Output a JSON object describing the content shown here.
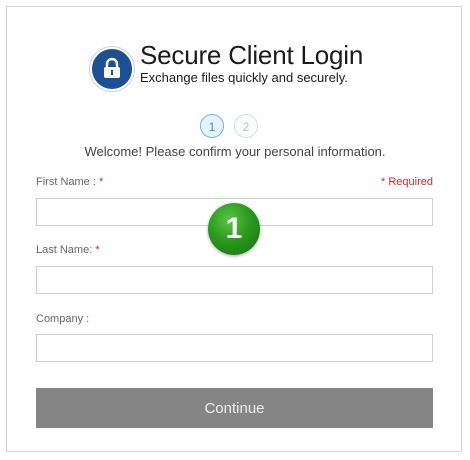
{
  "header": {
    "title": "Secure Client Login",
    "subtitle": "Exchange files quickly and securely.",
    "icon": "lock-icon",
    "icon_color": "#1d4f94"
  },
  "steps": [
    {
      "label": "1",
      "active": true
    },
    {
      "label": "2",
      "active": false
    }
  ],
  "welcome_text": "Welcome! Please confirm your personal information.",
  "required_note": "* Required",
  "form": {
    "first_name": {
      "label": "First Name :",
      "required_mark": "*",
      "value": "",
      "placeholder": ""
    },
    "last_name": {
      "label": "Last Name:",
      "required_mark": "*",
      "value": "",
      "placeholder": ""
    },
    "company": {
      "label": "Company :",
      "value": "",
      "placeholder": ""
    }
  },
  "continue_label": "Continue",
  "annotation_marker": "1",
  "colors": {
    "accent_step": "#6fb4d8",
    "required": "#d2232a",
    "button": "#858585",
    "marker": "#2a9a1c"
  }
}
